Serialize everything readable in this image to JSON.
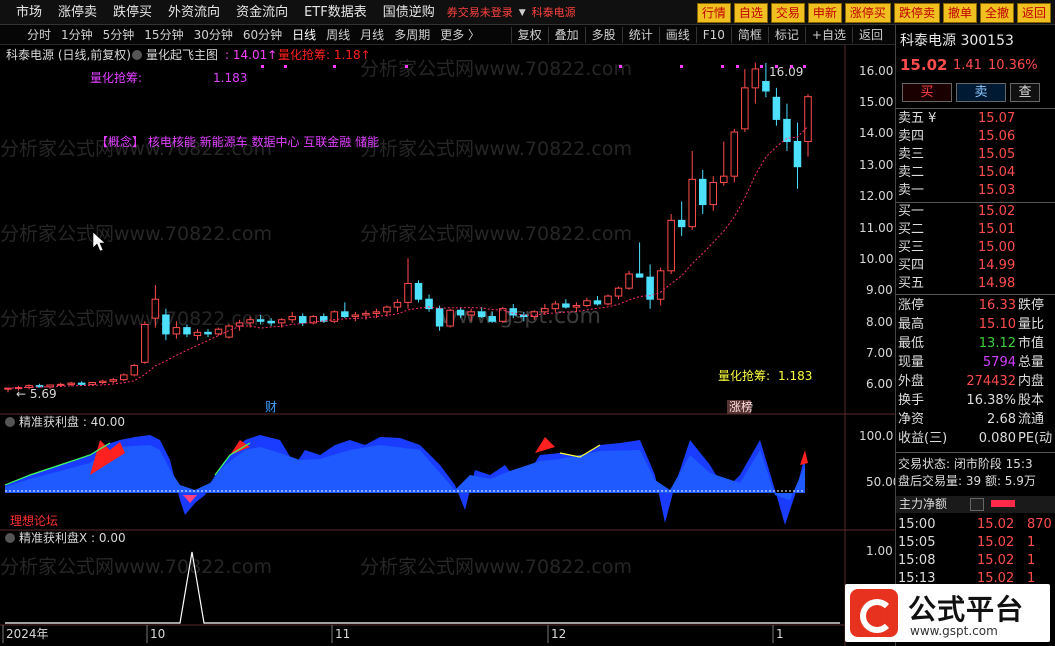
{
  "menu": {
    "items": [
      "市场",
      "涨停卖",
      "跌停买",
      "外资流向",
      "资金流向",
      "ETF数据表",
      "国债逆购"
    ],
    "warning": "券交易未登录",
    "stock_tag": "科泰电源",
    "buttons": [
      "行情",
      "自选",
      "交易",
      "申新",
      "涨停买",
      "跌停卖",
      "撤单",
      "全撤",
      "返回"
    ]
  },
  "periods": [
    "分时",
    "1分钟",
    "5分钟",
    "15分钟",
    "30分钟",
    "60分钟",
    "日线",
    "周线",
    "月线",
    "多周期",
    "更多 〉"
  ],
  "active_period": "日线",
  "tools": [
    "复权",
    "叠加",
    "多股",
    "统计",
    "画线",
    "F10",
    "简框",
    "标记",
    "+自选",
    "返回"
  ],
  "panes": {
    "main": {
      "title": "科泰电源 (日线,前复权)",
      "indicator": "量化起飞主图",
      "val1": ": 14.01↑",
      "val2": "量化抢筹: 1.18↑",
      "label_left": "量化抢筹:",
      "label_left_val": "1.183",
      "concepts": "【概念】   核电核能  新能源车  数据中心  互联金融  储能",
      "label_right": "量化抢筹:",
      "label_right_val": "1.183",
      "high_marker": "16.09",
      "low_marker": "← 5.69",
      "cai_tag": "财",
      "zhangbang_tag": "涨榜",
      "watermark": "分析家公式网www.70822.com",
      "watermark2": "www.gspt.com",
      "axis": [
        "16.00",
        "15.00",
        "14.00",
        "13.00",
        "12.00",
        "11.00",
        "10.00",
        "9.00",
        "8.00",
        "7.00",
        "6.00"
      ]
    },
    "sub1": {
      "title": "精准获利盘 : 40.00",
      "axis": [
        "100.0",
        "50.00"
      ],
      "tag": "理想论坛"
    },
    "sub2": {
      "title": "精准获利盘X : 0.00",
      "axis": [
        "1.00"
      ]
    },
    "xaxis": [
      "2024年",
      "10",
      "11",
      "12",
      "1"
    ]
  },
  "quote": {
    "name": "科泰电源",
    "code": "300153",
    "price": "15.02",
    "change": "1.41",
    "pct": "10.36%",
    "buy_label": "买",
    "sell_label": "卖",
    "query_label": "查",
    "asks": [
      {
        "label": "卖五 ¥",
        "price": "15.07"
      },
      {
        "label": "卖四",
        "price": "15.06"
      },
      {
        "label": "卖三",
        "price": "15.05"
      },
      {
        "label": "卖二",
        "price": "15.04"
      },
      {
        "label": "卖一",
        "price": "15.03"
      }
    ],
    "bids": [
      {
        "label": "买一",
        "price": "15.02"
      },
      {
        "label": "买二",
        "price": "15.01"
      },
      {
        "label": "买三",
        "price": "15.00"
      },
      {
        "label": "买四",
        "price": "14.99"
      },
      {
        "label": "买五",
        "price": "14.98"
      }
    ],
    "stats": [
      {
        "l1": "涨停",
        "v1": "16.33",
        "c": "#ff4d4d",
        "l2": "跌停"
      },
      {
        "l1": "最高",
        "v1": "15.10",
        "c": "#ff4d4d",
        "l2": "量比"
      },
      {
        "l1": "最低",
        "v1": "13.12",
        "c": "#3ad13a",
        "l2": "市值"
      },
      {
        "l1": "现量",
        "v1": "5794",
        "c": "#d040ff",
        "l2": "总量"
      },
      {
        "l1": "外盘",
        "v1": "274432",
        "c": "#ff4d4d",
        "l2": "内盘"
      },
      {
        "l1": "换手",
        "v1": "16.38%",
        "c": "#dddddd",
        "l2": "股本"
      },
      {
        "l1": "净资",
        "v1": "2.68",
        "c": "#dddddd",
        "l2": "流通"
      },
      {
        "l1": "收益(三)",
        "v1": "0.080",
        "c": "#dddddd",
        "l2": "PE(动"
      }
    ],
    "status1": "交易状态: 闭市阶段 15:3",
    "status2": "盘后交易量: 39  额: 5.9万",
    "flow_header": "主力净额",
    "ticks": [
      {
        "t": "15:00",
        "p": "15.02",
        "v": "870"
      },
      {
        "t": "15:05",
        "p": "15.02",
        "v": "1"
      },
      {
        "t": "15:08",
        "p": "15.02",
        "v": "1"
      },
      {
        "t": "15:13",
        "p": "15.02",
        "v": "1"
      }
    ]
  },
  "logo": {
    "name": "公式平台",
    "url": "www.gspt.com"
  },
  "colors": {
    "up": "#ff4d4d",
    "down": "#4de0ff",
    "bg": "#000000",
    "accent": "#f0c020",
    "blue": "#1e4ef0"
  },
  "chart_data": {
    "type": "candlestick",
    "ylim": [
      5.5,
      16.5
    ],
    "candles": [
      [
        5.75,
        5.8,
        5.65,
        5.78
      ],
      [
        5.78,
        5.85,
        5.7,
        5.8
      ],
      [
        5.8,
        5.9,
        5.74,
        5.86
      ],
      [
        5.86,
        5.92,
        5.8,
        5.82
      ],
      [
        5.82,
        5.9,
        5.76,
        5.88
      ],
      [
        5.88,
        5.95,
        5.82,
        5.9
      ],
      [
        5.9,
        5.98,
        5.84,
        5.94
      ],
      [
        5.94,
        6.0,
        5.86,
        5.9
      ],
      [
        5.9,
        5.98,
        5.85,
        5.96
      ],
      [
        5.96,
        6.05,
        5.9,
        6.0
      ],
      [
        6.0,
        6.1,
        5.94,
        6.05
      ],
      [
        6.05,
        6.25,
        6.0,
        6.2
      ],
      [
        6.2,
        6.55,
        6.15,
        6.5
      ],
      [
        6.6,
        7.9,
        6.55,
        7.8
      ],
      [
        8.0,
        9.05,
        7.7,
        8.6
      ],
      [
        8.1,
        8.3,
        7.3,
        7.5
      ],
      [
        7.5,
        7.9,
        7.35,
        7.7
      ],
      [
        7.7,
        7.8,
        7.4,
        7.5
      ],
      [
        7.45,
        7.65,
        7.3,
        7.55
      ],
      [
        7.55,
        7.65,
        7.4,
        7.5
      ],
      [
        7.5,
        7.7,
        7.45,
        7.65
      ],
      [
        7.4,
        7.8,
        7.35,
        7.75
      ],
      [
        7.75,
        7.95,
        7.6,
        7.85
      ],
      [
        7.85,
        8.05,
        7.7,
        7.95
      ],
      [
        7.95,
        8.1,
        7.8,
        7.9
      ],
      [
        7.9,
        8.0,
        7.75,
        7.85
      ],
      [
        7.85,
        8.0,
        7.7,
        7.95
      ],
      [
        7.95,
        8.2,
        7.85,
        8.05
      ],
      [
        8.05,
        8.15,
        7.75,
        7.85
      ],
      [
        7.85,
        8.1,
        7.8,
        8.05
      ],
      [
        8.05,
        8.15,
        7.85,
        7.9
      ],
      [
        7.9,
        8.25,
        7.85,
        8.2
      ],
      [
        8.2,
        8.5,
        8.0,
        8.05
      ],
      [
        8.05,
        8.2,
        7.9,
        8.1
      ],
      [
        8.1,
        8.25,
        7.95,
        8.15
      ],
      [
        8.15,
        8.3,
        8.0,
        8.2
      ],
      [
        8.2,
        8.4,
        8.05,
        8.35
      ],
      [
        8.35,
        8.6,
        8.2,
        8.5
      ],
      [
        8.5,
        9.9,
        8.3,
        9.1
      ],
      [
        9.1,
        9.2,
        8.5,
        8.6
      ],
      [
        8.6,
        8.75,
        8.2,
        8.3
      ],
      [
        8.3,
        8.4,
        7.6,
        7.75
      ],
      [
        7.75,
        8.3,
        7.7,
        8.25
      ],
      [
        8.25,
        8.35,
        8.0,
        8.1
      ],
      [
        8.1,
        8.3,
        7.9,
        8.2
      ],
      [
        8.2,
        8.35,
        8.0,
        8.05
      ],
      [
        8.05,
        8.2,
        7.85,
        7.9
      ],
      [
        7.9,
        8.35,
        7.85,
        8.3
      ],
      [
        8.3,
        8.45,
        8.0,
        8.1
      ],
      [
        8.1,
        8.2,
        7.9,
        8.05
      ],
      [
        8.05,
        8.25,
        7.95,
        8.2
      ],
      [
        8.2,
        8.45,
        8.1,
        8.3
      ],
      [
        8.3,
        8.55,
        8.2,
        8.45
      ],
      [
        8.45,
        8.6,
        8.3,
        8.35
      ],
      [
        8.35,
        8.5,
        8.2,
        8.4
      ],
      [
        8.4,
        8.65,
        8.35,
        8.55
      ],
      [
        8.55,
        8.7,
        8.4,
        8.45
      ],
      [
        8.45,
        8.75,
        8.4,
        8.7
      ],
      [
        8.7,
        9.0,
        8.6,
        8.95
      ],
      [
        8.95,
        9.5,
        8.9,
        9.4
      ],
      [
        9.4,
        10.4,
        9.3,
        9.3
      ],
      [
        9.3,
        9.7,
        8.3,
        8.6
      ],
      [
        8.6,
        9.6,
        8.4,
        9.5
      ],
      [
        9.5,
        11.3,
        9.4,
        11.1
      ],
      [
        11.1,
        11.7,
        10.6,
        10.9
      ],
      [
        10.9,
        13.3,
        10.8,
        12.4
      ],
      [
        12.4,
        12.7,
        11.3,
        11.6
      ],
      [
        11.6,
        12.5,
        11.4,
        12.3
      ],
      [
        12.3,
        13.6,
        12.2,
        12.5
      ],
      [
        12.5,
        14.0,
        12.3,
        13.9
      ],
      [
        14.0,
        15.9,
        13.9,
        15.3
      ],
      [
        15.3,
        16.1,
        14.8,
        15.9
      ],
      [
        15.5,
        16.09,
        15.0,
        15.2
      ],
      [
        15.0,
        15.3,
        14.1,
        14.3
      ],
      [
        14.3,
        14.8,
        13.3,
        13.6
      ],
      [
        13.6,
        14.2,
        12.1,
        12.8
      ],
      [
        13.6,
        15.1,
        13.12,
        15.02
      ]
    ]
  }
}
